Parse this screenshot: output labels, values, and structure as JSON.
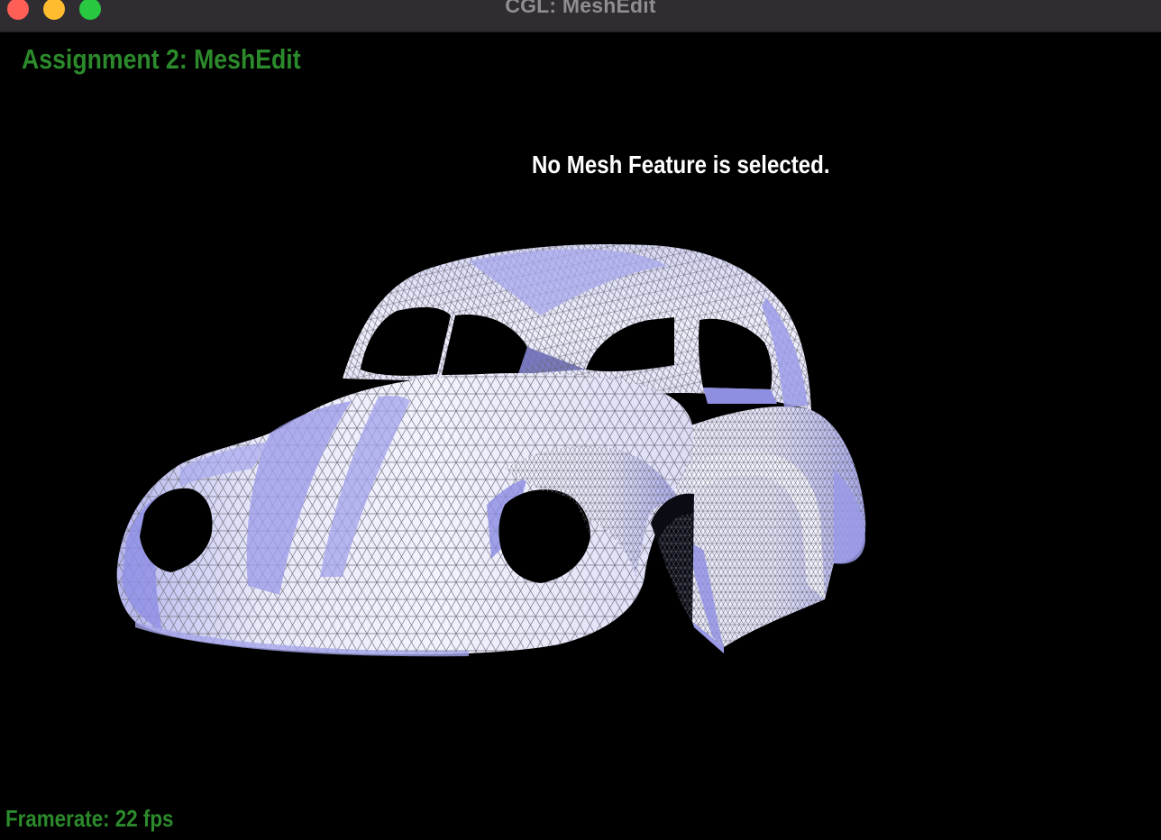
{
  "window": {
    "title": "CGL: MeshEdit",
    "controls": [
      "close",
      "minimize",
      "maximize"
    ]
  },
  "viewport": {
    "heading": "Assignment 2: MeshEdit",
    "status_message": "No Mesh Feature is selected.",
    "framerate_label": "Framerate: 22 fps"
  },
  "mesh": {
    "subject": "car-body-mesh",
    "shading": "lavender-blue flat shaded triangles with gray wireframe",
    "colors": {
      "base": "#ededfa",
      "shade": "#9c9cea",
      "wire": "#6e6e7a",
      "background": "#000000"
    }
  },
  "colors": {
    "heading_text": "#2c8a2c",
    "status_text": "#ffffff",
    "titlebar_bg": "#2f2d31",
    "close": "#ff5f57",
    "minimize": "#febc2e",
    "maximize": "#28c840"
  }
}
